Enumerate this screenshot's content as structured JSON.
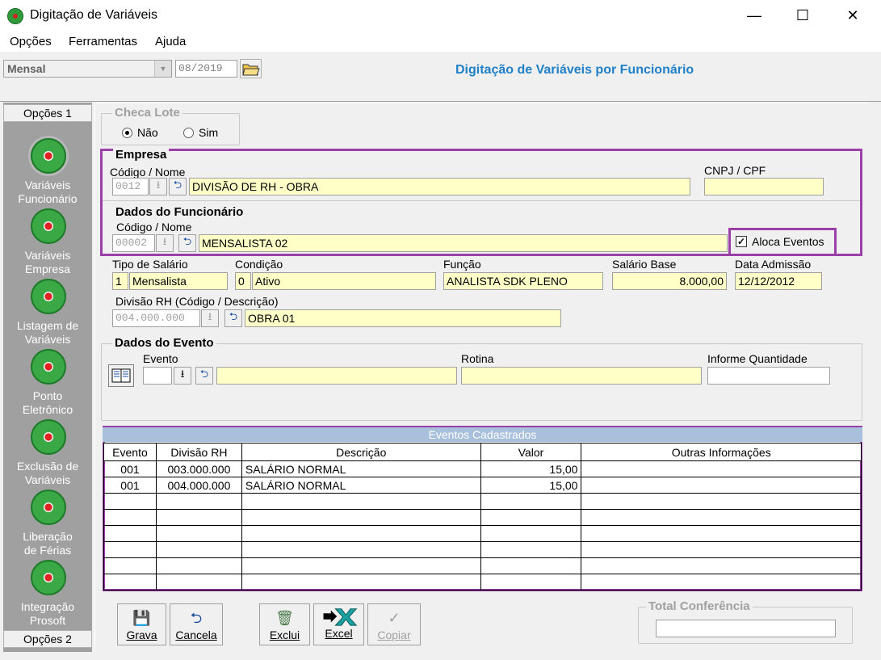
{
  "window": {
    "title": "Digitação de Variáveis",
    "minimize": "—",
    "maximize": "☐",
    "close": "✕"
  },
  "menu": [
    "Opções",
    "Ferramentas",
    "Ajuda"
  ],
  "toolbar": {
    "period_type": "Mensal",
    "period": "08/2019",
    "header_title": "Digitação de Variáveis por Funcionário"
  },
  "sidebar": {
    "tab1": "Opções 1",
    "tab2": "Opções 2",
    "items": [
      {
        "line1": "Variáveis",
        "line2": "Funcionário"
      },
      {
        "line1": "Variáveis",
        "line2": "Empresa"
      },
      {
        "line1": "Listagem de",
        "line2": "Variáveis"
      },
      {
        "line1": "Ponto",
        "line2": "Eletrônico"
      },
      {
        "line1": "Exclusão de",
        "line2": "Variáveis"
      },
      {
        "line1": "Liberação",
        "line2": "de Férias"
      },
      {
        "line1": "Integração",
        "line2": "Prosoft"
      }
    ]
  },
  "checa_lote": {
    "legend": "Checa Lote",
    "options": [
      "Não",
      "Sim"
    ],
    "selected": "Não"
  },
  "empresa": {
    "legend": "Empresa",
    "label": "Código / Nome",
    "code": "0012",
    "name": "DIVISÃO DE RH - OBRA",
    "cnpj_label": "CNPJ / CPF",
    "cnpj": ""
  },
  "funcionario": {
    "legend": "Dados do Funcionário",
    "label": "Código / Nome",
    "code": "00002",
    "name": "MENSALISTA 02",
    "aloca_label": "Aloca Eventos",
    "aloca_checked": true
  },
  "detalhes": {
    "tipo_label": "Tipo de Salário",
    "tipo_code": "1",
    "tipo_desc": "Mensalista",
    "cond_label": "Condição",
    "cond_code": "0",
    "cond_desc": "Ativo",
    "funcao_label": "Função",
    "funcao": "ANALISTA SDK PLENO",
    "salario_label": "Salário Base",
    "salario": "8.000,00",
    "admissao_label": "Data Admissão",
    "admissao": "12/12/2012",
    "divisao_label": "Divisão RH (Código / Descrição)",
    "divisao_code": "004.000.000",
    "divisao_desc": "OBRA 01"
  },
  "evento": {
    "legend": "Dados do Evento",
    "evento_label": "Evento",
    "evento_code": "",
    "evento_desc": "",
    "rotina_label": "Rotina",
    "rotina": "",
    "qtd_label": "Informe Quantidade",
    "qtd": ""
  },
  "grid": {
    "title": "Eventos Cadastrados",
    "columns": [
      "Evento",
      "Divisão RH",
      "Descrição",
      "Valor",
      "Outras Informações"
    ],
    "rows": [
      [
        "001",
        "003.000.000",
        "SALÁRIO NORMAL",
        "15,00",
        ""
      ],
      [
        "001",
        "004.000.000",
        "SALÁRIO NORMAL",
        "15,00",
        ""
      ],
      [
        "",
        "",
        "",
        "",
        ""
      ],
      [
        "",
        "",
        "",
        "",
        ""
      ],
      [
        "",
        "",
        "",
        "",
        ""
      ],
      [
        "",
        "",
        "",
        "",
        ""
      ],
      [
        "",
        "",
        "",
        "",
        ""
      ],
      [
        "",
        "",
        "",
        "",
        ""
      ]
    ]
  },
  "buttons": {
    "grava": "Grava",
    "cancela": "Cancela",
    "exclui": "Exclui",
    "excel": "Excel",
    "copiar": "Copiar"
  },
  "total": {
    "legend": "Total Conferência",
    "value": ""
  },
  "colors": {
    "accent": "#1f7fc7",
    "highlight": "#9b40a8",
    "field_bg": "#ffffc8",
    "grid_header": "#a8c0dc"
  }
}
